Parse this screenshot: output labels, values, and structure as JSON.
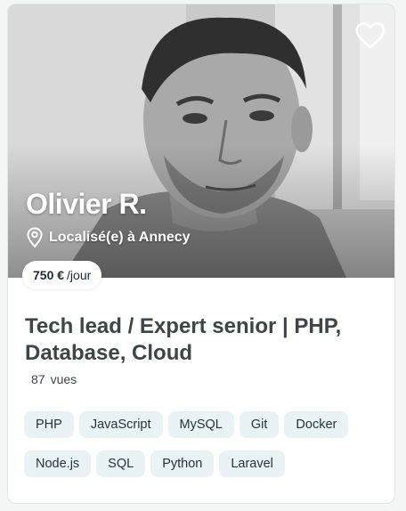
{
  "profile": {
    "name": "Olivier R.",
    "location": "Localisé(e) à Annecy",
    "price_amount": "750 €",
    "price_unit": "/jour",
    "title": "Tech lead / Expert senior | PHP, Database, Cloud",
    "views_count": "87",
    "views_label": "vues",
    "photo_style": "black-and-white portrait"
  },
  "icons": {
    "favorite": "heart-outline-icon",
    "location": "map-pin-icon"
  },
  "skills": [
    "PHP",
    "JavaScript",
    "MySQL",
    "Git",
    "Docker",
    "Node.js",
    "SQL",
    "Python",
    "Laravel"
  ],
  "colors": {
    "tag_bg": "#e9f3f5",
    "title_text": "#3d4548",
    "overlay_text": "#ffffff"
  }
}
